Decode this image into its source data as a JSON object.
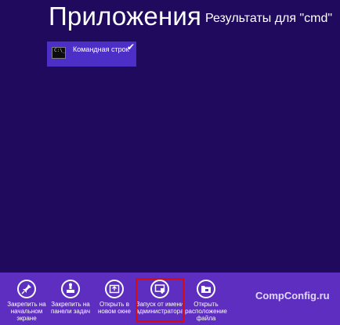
{
  "header": {
    "title": "Приложения",
    "subtitle": "Результаты для \"cmd\""
  },
  "results": [
    {
      "label": "Командная строка",
      "icon": "cmd-terminal-icon",
      "icon_text": "C:\\_",
      "selected": true,
      "check": "✔"
    }
  ],
  "appbar": {
    "commands": [
      {
        "label": "Закрепить на начальном экране",
        "icon": "pin-icon"
      },
      {
        "label": "Закрепить на панели задач",
        "icon": "taskbar-pin-icon"
      },
      {
        "label": "Открыть в новом окне",
        "icon": "new-window-icon"
      },
      {
        "label": "Запуск от имени администратора",
        "icon": "run-as-admin-icon",
        "highlighted": true
      },
      {
        "label": "Открыть расположение файла",
        "icon": "folder-icon"
      }
    ]
  },
  "watermark": "CompConfig.ru",
  "colors": {
    "background": "#1f0a5e",
    "tile": "#4c2fc6",
    "appbar": "#5d2ebf",
    "highlight_border": "#d40c12"
  }
}
